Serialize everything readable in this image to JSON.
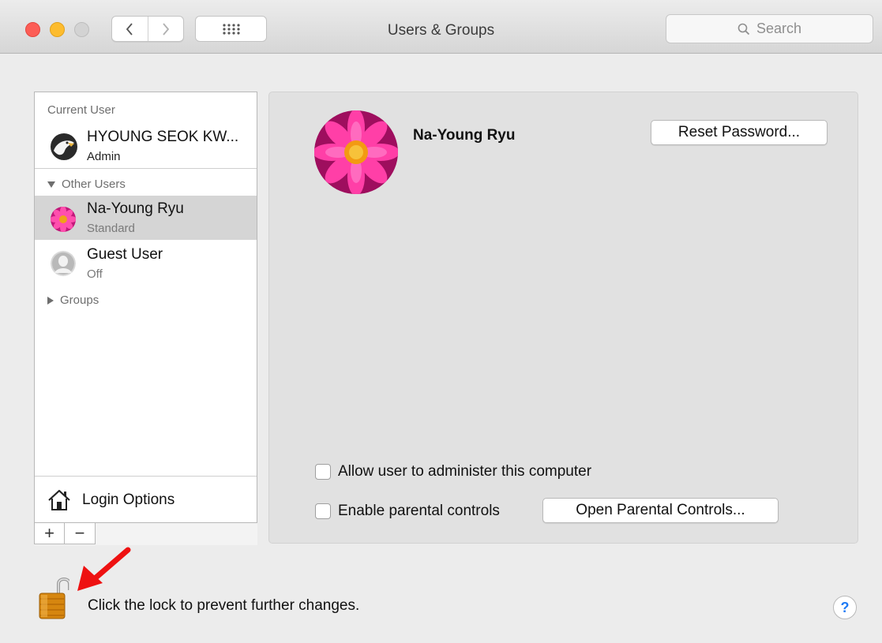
{
  "window": {
    "title": "Users & Groups",
    "search_placeholder": "Search"
  },
  "sidebar": {
    "current_user_label": "Current User",
    "current_user": {
      "name": "HYOUNG SEOK KW...",
      "role": "Admin",
      "avatar_icon": "eagle-avatar-icon"
    },
    "other_users_label": "Other Users",
    "other_users": [
      {
        "name": "Na-Young Ryu",
        "role": "Standard",
        "avatar_icon": "flower-avatar-icon",
        "selected": true
      },
      {
        "name": "Guest User",
        "role": "Off",
        "avatar_icon": "guest-avatar-icon",
        "selected": false
      }
    ],
    "groups_label": "Groups",
    "login_options_label": "Login Options",
    "add_label": "+",
    "remove_label": "−"
  },
  "detail": {
    "user_name": "Na-Young Ryu",
    "reset_password_label": "Reset Password...",
    "allow_admin_label": "Allow user to administer this computer",
    "allow_admin_checked": false,
    "parental_controls_label": "Enable parental controls",
    "parental_controls_checked": false,
    "open_parental_label": "Open Parental Controls..."
  },
  "footer": {
    "lock_text": "Click the lock to prevent further changes.",
    "lock_state": "unlocked",
    "help_label": "?"
  },
  "colors": {
    "close": "#fc5d56",
    "minimize": "#fdbc2e",
    "annotation_arrow": "#ee1111",
    "selection": "#d5d5d5"
  }
}
